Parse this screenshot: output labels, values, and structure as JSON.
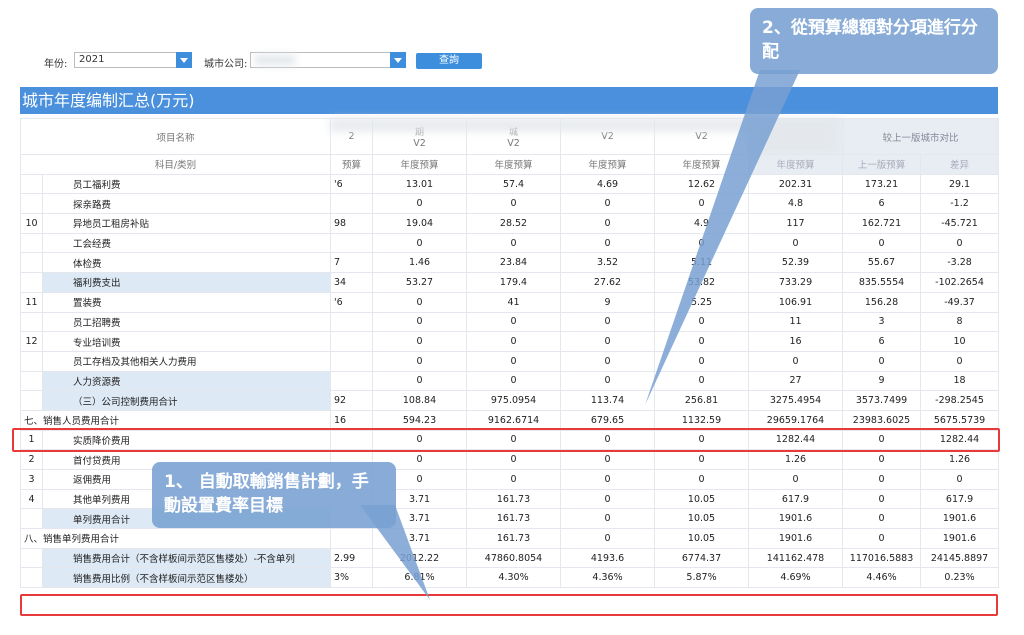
{
  "filters": {
    "year_label": "年份:",
    "year_value": "2021",
    "city_label": "城市公司:",
    "city_value": "",
    "query_button": "查詢"
  },
  "title": "城市年度编制汇总(万元)",
  "headers": {
    "item_name": "项目名称",
    "subject": "科目/类别",
    "comparison_group": "较上一版城市对比",
    "versions": [
      "2",
      "V2",
      "V2",
      "V2",
      "V2"
    ],
    "version_top": [
      "",
      "期",
      "城",
      "",
      ""
    ],
    "metrics": [
      "预算",
      "年度预算",
      "年度预算",
      "年度预算",
      "年度预算",
      "年度预算",
      "上一版预算",
      "差异"
    ]
  },
  "rows": [
    {
      "num": "",
      "name": "员工福利费",
      "vals": [
        "'6",
        "13.01",
        "57.4",
        "4.69",
        "12.62",
        "202.31",
        "173.21",
        "29.1"
      ]
    },
    {
      "num": "",
      "name": "探亲路费",
      "vals": [
        "",
        "0",
        "0",
        "0",
        "0",
        "4.8",
        "6",
        "-1.2"
      ]
    },
    {
      "num": "10",
      "name": "异地员工租房补贴",
      "vals": [
        "98",
        "19.04",
        "28.52",
        "0",
        "4.9",
        "117",
        "162.721",
        "-45.721"
      ]
    },
    {
      "num": "",
      "name": "工会经费",
      "vals": [
        "",
        "0",
        "0",
        "0",
        "0",
        "0",
        "0",
        "0"
      ]
    },
    {
      "num": "",
      "name": "体检费",
      "vals": [
        "7",
        "1.46",
        "23.84",
        "3.52",
        "5.11",
        "52.39",
        "55.67",
        "-3.28"
      ]
    },
    {
      "num": "",
      "name": "福利费支出",
      "vals": [
        "34",
        "53.27",
        "179.4",
        "27.62",
        "53.82",
        "733.29",
        "835.5554",
        "-102.2654"
      ],
      "tint": true
    },
    {
      "num": "11",
      "name": "置装费",
      "vals": [
        "'6",
        "0",
        "41",
        "9",
        "5.25",
        "106.91",
        "156.28",
        "-49.37"
      ]
    },
    {
      "num": "",
      "name": "员工招聘费",
      "vals": [
        "",
        "0",
        "0",
        "0",
        "0",
        "11",
        "3",
        "8"
      ]
    },
    {
      "num": "12",
      "name": "专业培训费",
      "vals": [
        "",
        "0",
        "0",
        "0",
        "0",
        "16",
        "6",
        "10"
      ]
    },
    {
      "num": "",
      "name": "员工存档及其他相关人力费用",
      "vals": [
        "",
        "0",
        "0",
        "0",
        "0",
        "0",
        "0",
        "0"
      ]
    },
    {
      "num": "",
      "name": "人力资源费",
      "vals": [
        "",
        "0",
        "0",
        "0",
        "0",
        "27",
        "9",
        "18"
      ],
      "tint": true
    },
    {
      "num": "",
      "name": "（三）公司控制费用合计",
      "vals": [
        "92",
        "108.84",
        "975.0954",
        "113.74",
        "256.81",
        "3275.4954",
        "3573.7499",
        "-298.2545"
      ],
      "tint": true
    },
    {
      "num": "",
      "name": "七、销售人员费用合计",
      "vals": [
        "16",
        "594.23",
        "9162.6714",
        "679.65",
        "1132.59",
        "29659.1764",
        "23983.6025",
        "5675.5739"
      ],
      "full": true
    },
    {
      "num": "1",
      "name": "实质降价费用",
      "vals": [
        "",
        "0",
        "0",
        "0",
        "0",
        "1282.44",
        "0",
        "1282.44"
      ]
    },
    {
      "num": "2",
      "name": "首付贷费用",
      "vals": [
        "",
        "0",
        "0",
        "0",
        "0",
        "1.26",
        "0",
        "1.26"
      ]
    },
    {
      "num": "3",
      "name": "返佣费用",
      "vals": [
        "",
        "0",
        "0",
        "0",
        "0",
        "0",
        "0",
        "0"
      ]
    },
    {
      "num": "4",
      "name": "其他单列费用",
      "vals": [
        "",
        "3.71",
        "161.73",
        "0",
        "10.05",
        "617.9",
        "0",
        "617.9"
      ]
    },
    {
      "num": "",
      "name": "单列费用合计",
      "vals": [
        "",
        "3.71",
        "161.73",
        "0",
        "10.05",
        "1901.6",
        "0",
        "1901.6"
      ],
      "tint": true
    },
    {
      "num": "",
      "name": "八、销售单列费用合计",
      "vals": [
        "",
        "3.71",
        "161.73",
        "0",
        "10.05",
        "1901.6",
        "0",
        "1901.6"
      ],
      "full": true
    },
    {
      "num": "",
      "name": "销售费用合计（不含样板间示范区售楼处）-不含单列",
      "vals": [
        "2.99",
        "2012.22",
        "47860.8054",
        "4193.6",
        "6774.37",
        "141162.478",
        "117016.5883",
        "24145.8897"
      ],
      "tint": true
    },
    {
      "num": "",
      "name": "销售费用比例（不含样板间示范区售楼处）",
      "vals": [
        "3%",
        "6.81%",
        "4.30%",
        "4.36%",
        "5.87%",
        "4.69%",
        "4.46%",
        "0.23%"
      ],
      "tint": true
    }
  ],
  "callouts": {
    "top_right": "2、從預算總額對分項進行分配",
    "bottom_left": "1、 自動取輸銷售計劃，手動設置費率目標"
  },
  "colors": {
    "accent": "#4a90dc",
    "tint": "#dde9f5",
    "highlight_border": "#e83a3a",
    "callout_bg": "#78a0d2"
  }
}
